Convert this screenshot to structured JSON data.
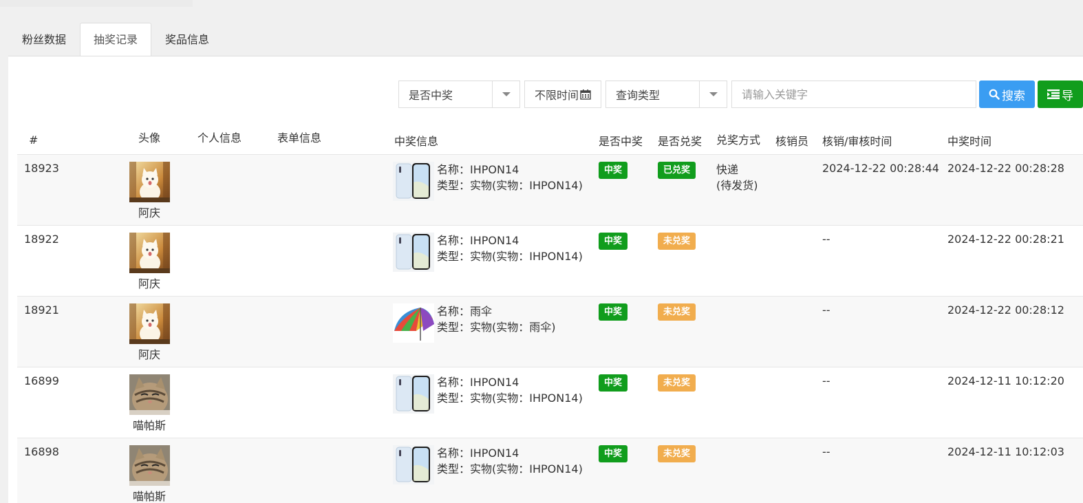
{
  "tabs": [
    "粉丝数据",
    "抽奖记录",
    "奖品信息"
  ],
  "filters": {
    "win_select": "是否中奖",
    "date": "不限时间",
    "query_type": "查询类型",
    "keyword_placeholder": "请输入关键字",
    "search_label": "搜索",
    "export_label": "导"
  },
  "columns": [
    "#",
    "头像",
    "个人信息",
    "表单信息",
    "中奖信息",
    "是否中奖",
    "是否兑奖",
    "兑奖方式",
    "核销员",
    "核销/审核时间",
    "中奖时间"
  ],
  "rows": [
    {
      "id": "18923",
      "nickname": "阿庆",
      "avatar": "golden-cat",
      "prize_img": "phone",
      "prize_name": "名称：IHPON14",
      "prize_type": "类型：实物(实物：IHPON14)",
      "win": "中奖",
      "redeem": "已兑奖",
      "redeem_status": "done",
      "method": "快递",
      "method_sub": "(待发货)",
      "verifier": "",
      "verify_time": "2024-12-22 00:28:44",
      "win_time": "2024-12-22 00:28:28"
    },
    {
      "id": "18922",
      "nickname": "阿庆",
      "avatar": "golden-cat",
      "prize_img": "phone",
      "prize_name": "名称：IHPON14",
      "prize_type": "类型：实物(实物：IHPON14)",
      "win": "中奖",
      "redeem": "未兑奖",
      "redeem_status": "pending",
      "method": "",
      "method_sub": "",
      "verifier": "",
      "verify_time": "--",
      "win_time": "2024-12-22 00:28:21"
    },
    {
      "id": "18921",
      "nickname": "阿庆",
      "avatar": "golden-cat",
      "prize_img": "umbrella",
      "prize_name": "名称：雨伞",
      "prize_type": "类型：实物(实物：雨伞)",
      "win": "中奖",
      "redeem": "未兑奖",
      "redeem_status": "pending",
      "method": "",
      "method_sub": "",
      "verifier": "",
      "verify_time": "--",
      "win_time": "2024-12-22 00:28:12"
    },
    {
      "id": "16899",
      "nickname": "喵帕斯",
      "avatar": "tabby-cat",
      "prize_img": "phone",
      "prize_name": "名称：IHPON14",
      "prize_type": "类型：实物(实物：IHPON14)",
      "win": "中奖",
      "redeem": "未兑奖",
      "redeem_status": "pending",
      "method": "",
      "method_sub": "",
      "verifier": "",
      "verify_time": "--",
      "win_time": "2024-12-11 10:12:20"
    },
    {
      "id": "16898",
      "nickname": "喵帕斯",
      "avatar": "tabby-cat",
      "prize_img": "phone",
      "prize_name": "名称：IHPON14",
      "prize_type": "类型：实物(实物：IHPON14)",
      "win": "中奖",
      "redeem": "未兑奖",
      "redeem_status": "pending",
      "method": "",
      "method_sub": "",
      "verifier": "",
      "verify_time": "--",
      "win_time": "2024-12-11 10:12:03"
    }
  ],
  "colors": {
    "green": "#119d1d",
    "orange": "#f1ad4e",
    "blue": "#3a9df2"
  }
}
